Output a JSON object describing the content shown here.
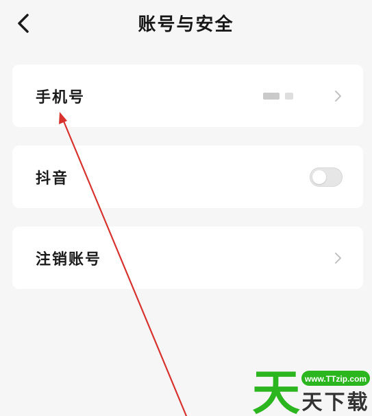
{
  "header": {
    "title": "账号与安全",
    "back_icon": "chevron-left-icon"
  },
  "settings": {
    "phone": {
      "label": "手机号",
      "value_masked": true,
      "chevron_icon": "chevron-right-icon"
    },
    "douyin": {
      "label": "抖音",
      "toggle_on": false
    },
    "cancel_account": {
      "label": "注销账号",
      "chevron_icon": "chevron-right-icon"
    }
  },
  "annotation": {
    "type": "red-arrow",
    "color": "#d32f2f"
  },
  "watermark": {
    "logo_char": "天",
    "url": "www.TTzip.com",
    "site_name": "天下载",
    "brand_green": "#2bb51f",
    "brand_text": "#333333"
  }
}
